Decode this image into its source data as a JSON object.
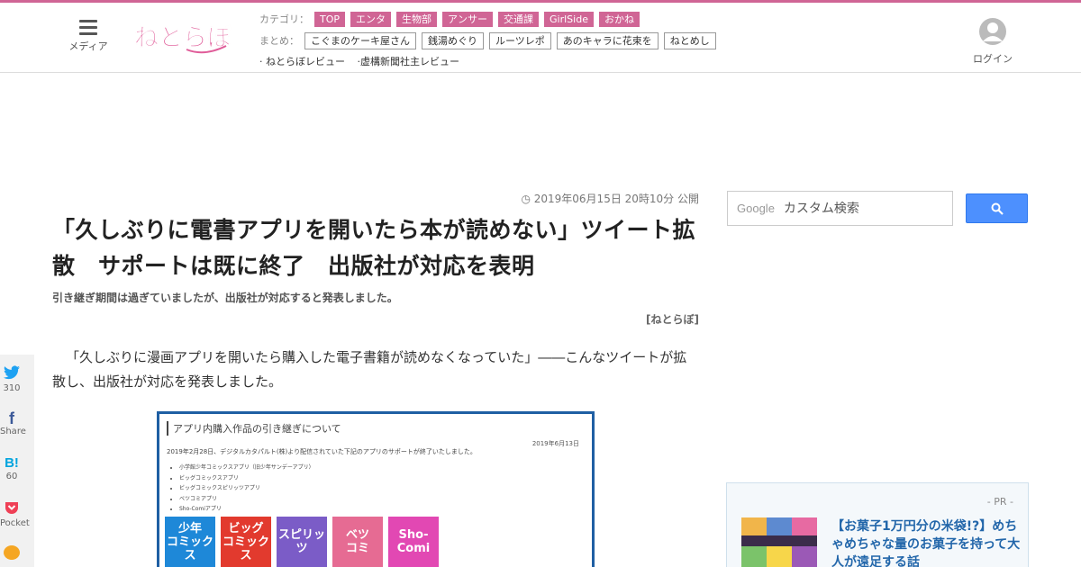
{
  "header": {
    "menu_label": "メディア",
    "logo_text": "ねとらぼ",
    "category_label": "カテゴリ：",
    "categories": [
      "TOP",
      "エンタ",
      "生物部",
      "アンサー",
      "交通課",
      "GirlSide",
      "おかね"
    ],
    "matome_label": "まとめ：",
    "matome": [
      "こぐまのケーキ屋さん",
      "銭湯めぐり",
      "ルーツレポ",
      "あのキャラに花束を",
      "ねとめし"
    ],
    "reviews": [
      "· ねとらぼレビュー",
      "·虚構新聞社主レビュー"
    ],
    "login_label": "ログイン",
    "accent_color": "#d06595"
  },
  "article": {
    "date": "2019年06月15日 20時10分 公開",
    "title": "「久しぶりに電書アプリを開いたら本が読めない」ツイート拡散　サポートは既に終了　出版社が対応を表明",
    "subtitle": "引き継ぎ期間は過ぎていましたが、出版社が対応すると発表しました。",
    "source": "[ねとらぼ]",
    "body": "「久しぶりに漫画アプリを開いたら購入した電子書籍が読めなくなっていた」――こんなツイートが拡散し、出版社が対応を発表しました。"
  },
  "figure": {
    "title": "アプリ内購入作品の引き継ぎについて",
    "date": "2019年6月13日",
    "line": "2019年2月28日、デジタルカタパルト(株)より配信されていた下記のアプリのサポートが終了いたしました。",
    "apps": [
      "小学館少年コミックスアプリ（旧少年サンデーアプリ）",
      "ビッグコミックスアプリ",
      "ビッグコミックスピリッツアプリ",
      "ベツコミアプリ",
      "Sho-Comiアプリ"
    ],
    "icons": [
      {
        "name": "shonen-comics",
        "label": "少年\nコミックス",
        "color": "#1e88d8"
      },
      {
        "name": "big-comics",
        "label": "ビッグ\nコミックス",
        "color": "#e23a2e"
      },
      {
        "name": "spirits",
        "label": "スピリッツ",
        "color": "#7b5cc7"
      },
      {
        "name": "betsucomi",
        "label": "ベツ\nコミ",
        "color": "#e66b93"
      },
      {
        "name": "shocomi",
        "label": "Sho-\nComi",
        "color": "#e248b3"
      }
    ]
  },
  "share": {
    "twitter_count": "310",
    "facebook_label": "Share",
    "hatena_count": "60",
    "pocket_label": "Pocket"
  },
  "sidebar": {
    "google_text": "Google",
    "search_placeholder": "カスタム検索",
    "pr_label": "- PR -",
    "pr_title": "【お菓子1万円分の米袋!?】めちゃめちゃな量のお菓子を持って大人が遠足する話"
  }
}
